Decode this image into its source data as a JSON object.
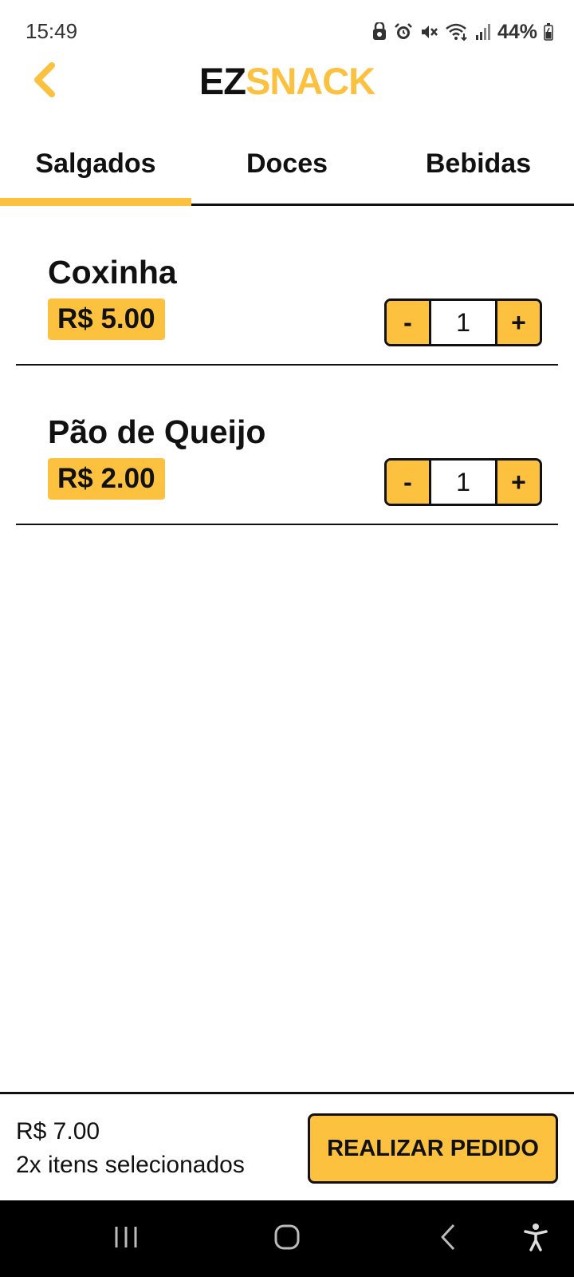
{
  "status_bar": {
    "time": "15:49",
    "battery": "44%",
    "icons": [
      "privacy-icon",
      "alarm-icon",
      "mute-icon",
      "wifi-icon",
      "signal-icon",
      "battery-icon"
    ]
  },
  "header": {
    "logo_part1": "EZ",
    "logo_part2": "SNACK",
    "back_icon": "chevron-left-icon"
  },
  "tabs": [
    {
      "label": "Salgados",
      "active": true
    },
    {
      "label": "Doces",
      "active": false
    },
    {
      "label": "Bebidas",
      "active": false
    }
  ],
  "products": [
    {
      "name": "Coxinha",
      "price": "R$ 5.00",
      "quantity": "1",
      "minus": "-",
      "plus": "+"
    },
    {
      "name": "Pão de Queijo",
      "price": "R$ 2.00",
      "quantity": "1",
      "minus": "-",
      "plus": "+"
    }
  ],
  "order": {
    "total": "R$ 7.00",
    "count": "2x itens selecionados",
    "button_label": "REALIZAR PEDIDO"
  },
  "nav_bar": {
    "icons": [
      "recent-apps-icon",
      "home-icon",
      "back-icon",
      "accessibility-icon"
    ]
  },
  "colors": {
    "accent": "#fbc13f",
    "text": "#111111",
    "background": "#ffffff",
    "nav_background": "#000000"
  }
}
